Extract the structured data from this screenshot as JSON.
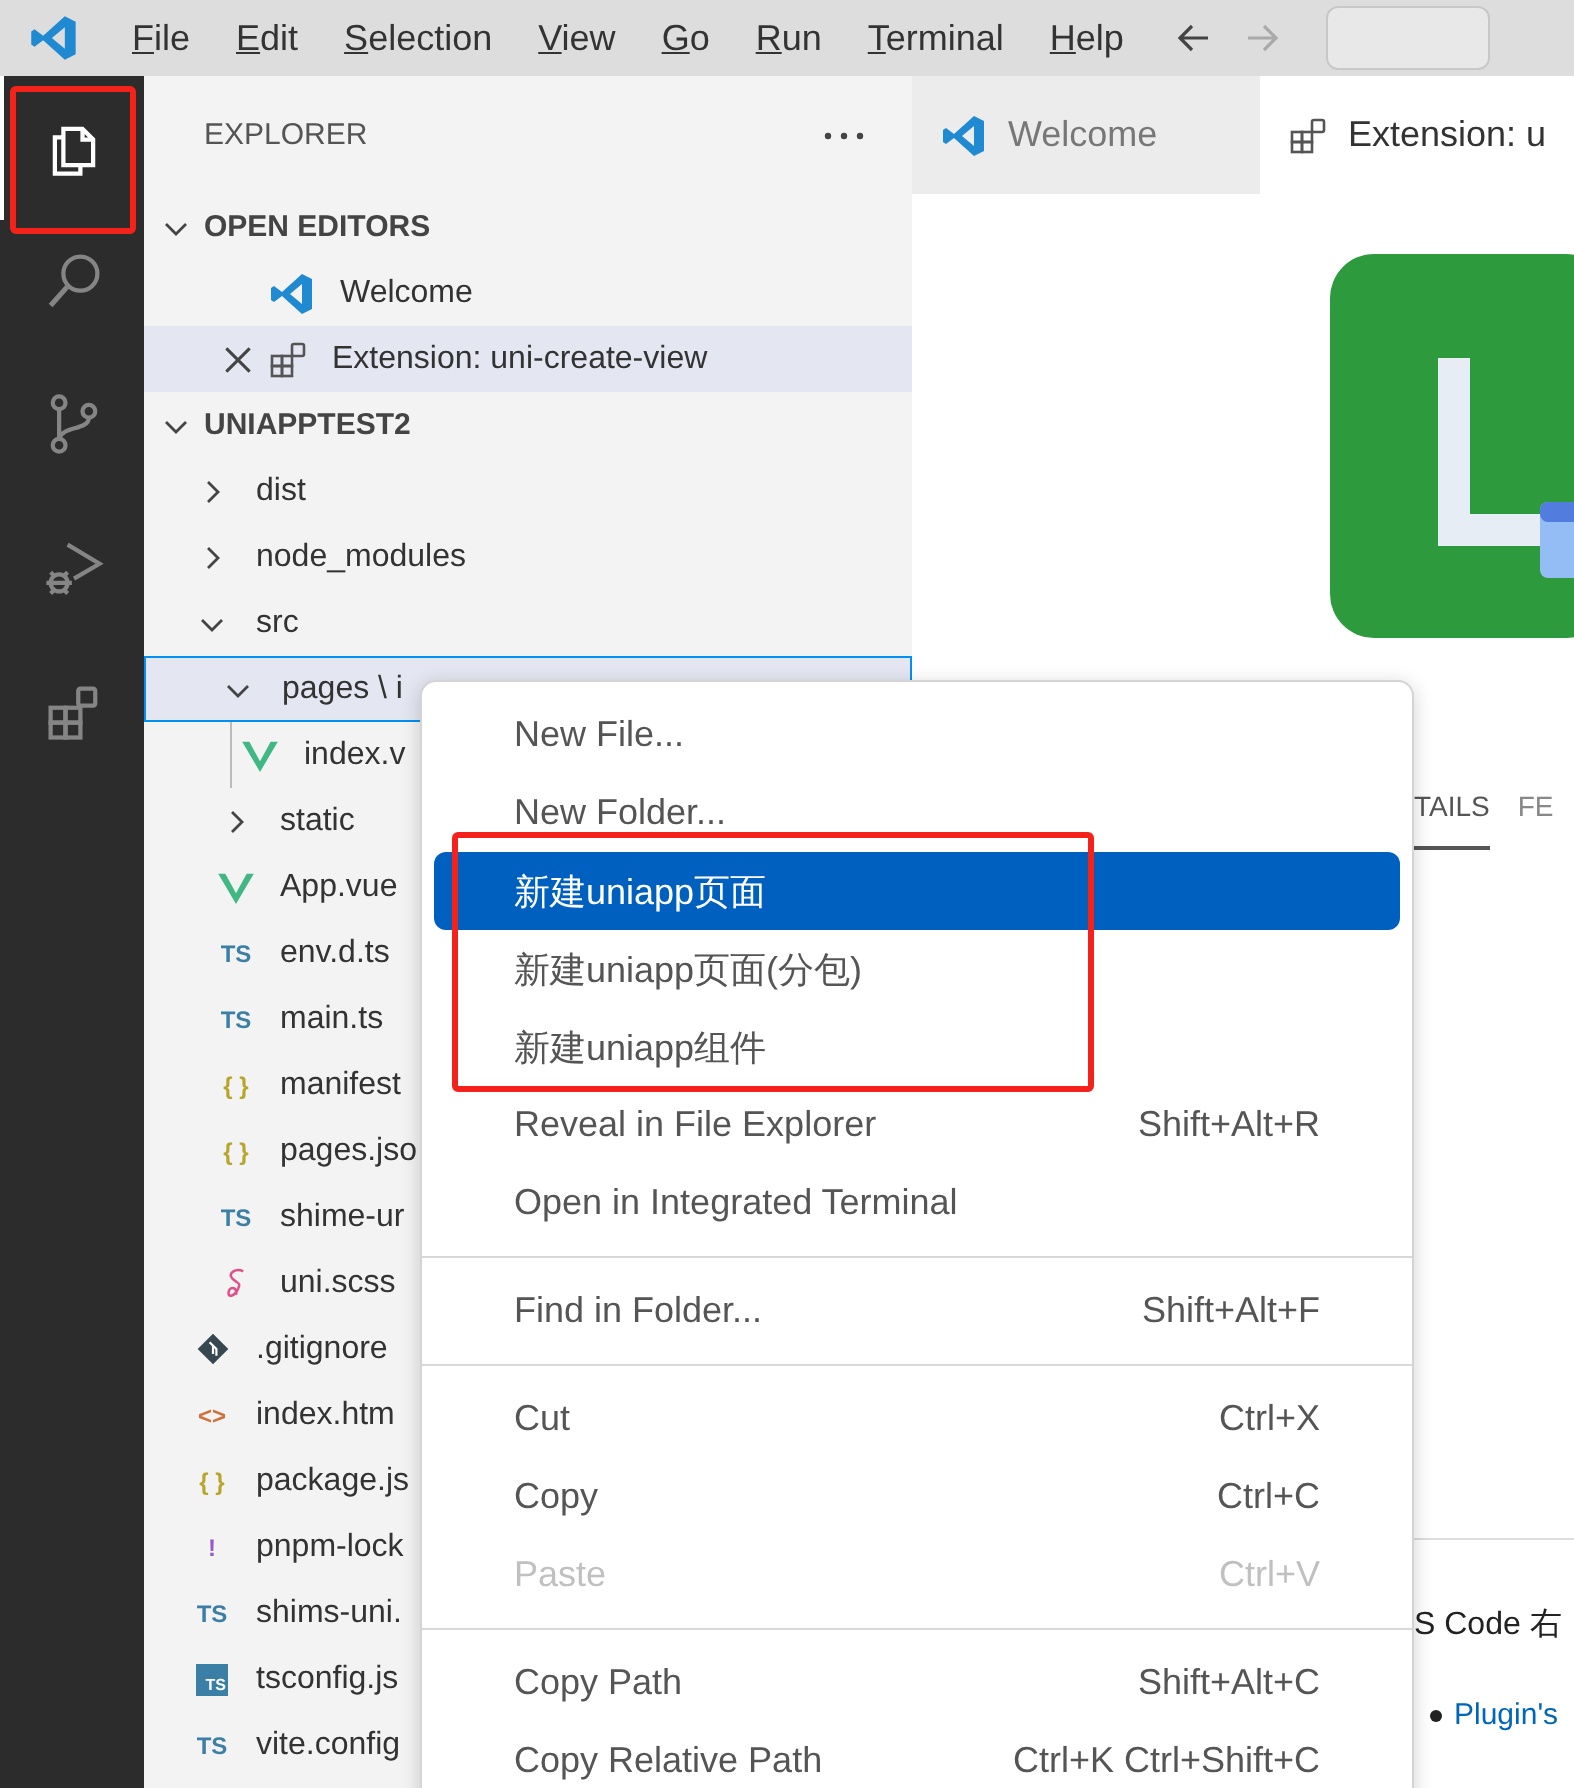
{
  "title_bar": {
    "menu": [
      "File",
      "Edit",
      "Selection",
      "View",
      "Go",
      "Run",
      "Terminal",
      "Help"
    ]
  },
  "activity_bar": [
    {
      "selected": true
    },
    {
      "selected": false
    },
    {
      "selected": false
    },
    {
      "selected": false
    },
    {
      "selected": false
    }
  ],
  "explorer": {
    "title": "EXPLORER",
    "open_editors": {
      "title": "OPEN EDITORS",
      "expanded": true,
      "items": [
        {
          "kind": "vscode",
          "label": "Welcome",
          "selected": false
        },
        {
          "kind": "extension",
          "label": "Extension: uni-create-view",
          "selected": true
        }
      ]
    },
    "workspace": {
      "title": "UNIAPPTEST2",
      "expanded": true,
      "children": [
        {
          "kind": "folder",
          "label": "dist",
          "expanded": false,
          "selected": false
        },
        {
          "kind": "folder",
          "label": "node_modules",
          "expanded": false,
          "selected": false
        },
        {
          "kind": "folder",
          "label": "src",
          "expanded": true,
          "selected": false,
          "children": [
            {
              "kind": "folder",
              "label": "pages \\ i",
              "expanded": true,
              "selected": true,
              "children": [
                {
                  "kind": "vue",
                  "label": "index.v",
                  "selected": false
                }
              ]
            },
            {
              "kind": "folder",
              "label": "static",
              "expanded": false,
              "selected": false
            },
            {
              "kind": "vue",
              "label": "App.vue",
              "selected": false
            },
            {
              "kind": "ts",
              "glyph": "TS",
              "label": "env.d.ts",
              "selected": false
            },
            {
              "kind": "ts",
              "glyph": "TS",
              "label": "main.ts",
              "selected": false
            },
            {
              "kind": "json",
              "glyph": "{ }",
              "label": "manifest",
              "selected": false
            },
            {
              "kind": "json",
              "glyph": "{ }",
              "label": "pages.jso",
              "selected": false
            },
            {
              "kind": "ts",
              "glyph": "TS",
              "label": "shime-ur",
              "selected": false
            },
            {
              "kind": "sass",
              "label": "uni.scss",
              "selected": false
            }
          ]
        },
        {
          "kind": "git",
          "label": ".gitignore",
          "selected": false
        },
        {
          "kind": "html",
          "glyph": "<>",
          "label": "index.htm",
          "selected": false
        },
        {
          "kind": "json",
          "glyph": "{ }",
          "label": "package.js",
          "selected": false
        },
        {
          "kind": "yaml",
          "glyph": "!",
          "label": "pnpm-lock",
          "selected": false
        },
        {
          "kind": "ts",
          "glyph": "TS",
          "label": "shims-uni.",
          "selected": false
        },
        {
          "kind": "tsconfig",
          "glyph": "TS",
          "label": "tsconfig.js",
          "selected": false
        },
        {
          "kind": "ts",
          "glyph": "TS",
          "label": "vite.config",
          "selected": false
        }
      ]
    }
  },
  "editor": {
    "tabs": [
      {
        "kind": "vscode",
        "label": "Welcome",
        "selected": false
      },
      {
        "kind": "extension",
        "label": "Extension: u",
        "selected": true
      }
    ],
    "detail_tabs": [
      {
        "label": "TAILS",
        "selected": true
      },
      {
        "label": "FE",
        "selected": false
      }
    ],
    "text": "S Code 右",
    "link": "Plugin's"
  },
  "context_menu": {
    "groups": [
      [
        {
          "label": "New File...",
          "selected": false,
          "disabled": false
        },
        {
          "label": "New Folder...",
          "selected": false,
          "disabled": false
        },
        {
          "label": "新建uniapp页面",
          "selected": true,
          "disabled": false
        },
        {
          "label": "新建uniapp页面(分包)",
          "selected": false,
          "disabled": false
        },
        {
          "label": "新建uniapp组件",
          "selected": false,
          "disabled": false
        },
        {
          "label": "Reveal in File Explorer",
          "shortcut": "Shift+Alt+R",
          "selected": false,
          "disabled": false
        },
        {
          "label": "Open in Integrated Terminal",
          "selected": false,
          "disabled": false
        }
      ],
      [
        {
          "label": "Find in Folder...",
          "shortcut": "Shift+Alt+F",
          "selected": false,
          "disabled": false
        }
      ],
      [
        {
          "label": "Cut",
          "shortcut": "Ctrl+X",
          "selected": false,
          "disabled": false
        },
        {
          "label": "Copy",
          "shortcut": "Ctrl+C",
          "selected": false,
          "disabled": false
        },
        {
          "label": "Paste",
          "shortcut": "Ctrl+V",
          "selected": false,
          "disabled": true
        }
      ],
      [
        {
          "label": "Copy Path",
          "shortcut": "Shift+Alt+C",
          "selected": false,
          "disabled": false
        },
        {
          "label": "Copy Relative Path",
          "shortcut": "Ctrl+K Ctrl+Shift+C",
          "selected": false,
          "disabled": false
        }
      ]
    ]
  }
}
